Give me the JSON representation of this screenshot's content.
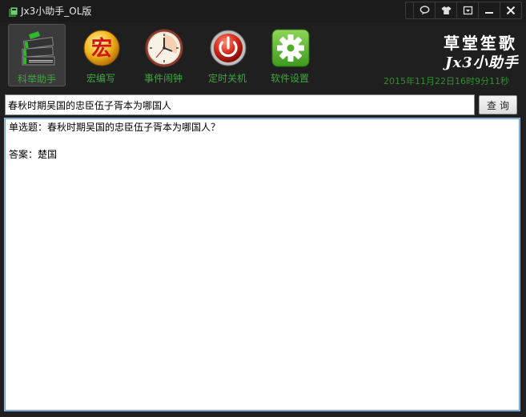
{
  "window": {
    "title": "Jx3小助手_OL版",
    "controls": [
      {
        "name": "chat-icon",
        "symbol": "💬"
      },
      {
        "name": "skin-icon",
        "symbol": "👕"
      },
      {
        "name": "menu-icon",
        "symbol": "▾"
      },
      {
        "name": "minimize-icon",
        "symbol": "—"
      },
      {
        "name": "close-icon",
        "symbol": "✕"
      }
    ]
  },
  "toolbar": {
    "items": [
      {
        "label": "科举助手",
        "icon": "books-icon",
        "active": true
      },
      {
        "label": "宏编写",
        "icon": "macro-icon",
        "active": false
      },
      {
        "label": "事件闹钟",
        "icon": "clock-icon",
        "active": false
      },
      {
        "label": "定时关机",
        "icon": "power-icon",
        "active": false
      },
      {
        "label": "软件设置",
        "icon": "gear-icon",
        "active": false
      }
    ],
    "macro_glyph": "宏"
  },
  "brand": {
    "line1": "草堂笙歌",
    "line2": "Jx3小助手",
    "datetime": "2015年11月22日16时9分11秒"
  },
  "search": {
    "value": "春秋时期吴国的忠臣伍子胥本为哪国人",
    "button_label": "查询"
  },
  "result": {
    "question": "单选题：春秋时期吴国的忠臣伍子胥本为哪国人？",
    "answer": "答案：楚国"
  },
  "colors": {
    "accent_green": "#3fa63f",
    "background": "#1f1f1f",
    "result_border": "#6c9ac9"
  }
}
